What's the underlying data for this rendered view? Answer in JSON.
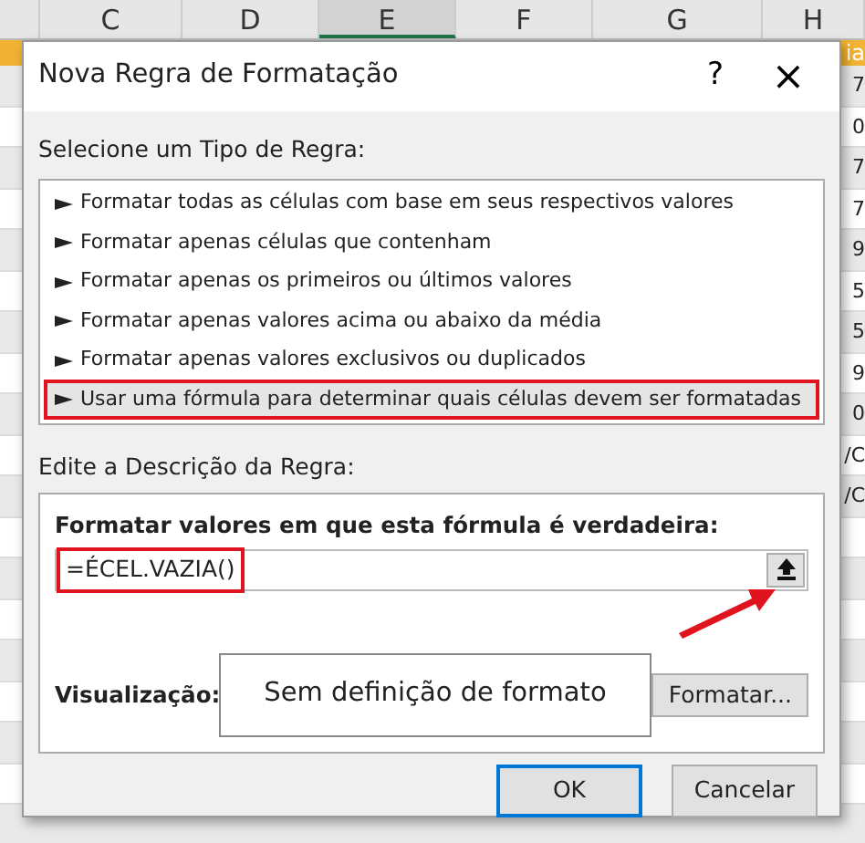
{
  "sheet": {
    "columns": [
      {
        "label": "C",
        "selected": false
      },
      {
        "label": "D",
        "selected": false
      },
      {
        "label": "E",
        "selected": true
      },
      {
        "label": "F",
        "selected": false
      },
      {
        "label": "G",
        "selected": false
      },
      {
        "label": "H",
        "selected": false
      }
    ],
    "header_fragment": "ia",
    "edge_fragments": [
      "7",
      "0",
      "7",
      "7",
      "9",
      "5",
      "5",
      "9",
      "0",
      "/C",
      "/C"
    ]
  },
  "dialog": {
    "title": "Nova Regra de Formatação",
    "help": "?",
    "close": "×",
    "rule_type_label": "Selecione um Tipo de Regra:",
    "rule_types": [
      {
        "label": "Formatar todas as células com base em seus respectivos valores",
        "selected": false
      },
      {
        "label": "Formatar apenas células que contenham",
        "selected": false
      },
      {
        "label": "Formatar apenas os primeiros ou últimos valores",
        "selected": false
      },
      {
        "label": "Formatar apenas valores acima ou abaixo da média",
        "selected": false
      },
      {
        "label": "Formatar apenas valores exclusivos ou duplicados",
        "selected": false
      },
      {
        "label": "Usar uma fórmula para determinar quais células devem ser formatadas",
        "selected": true
      }
    ],
    "description_label": "Edite a Descrição da Regra:",
    "formula_label": "Formatar valores em que esta fórmula é verdadeira:",
    "formula": {
      "value": "=ÉCEL.VAZIA()",
      "highlighted": true
    },
    "preview_label": "Visualização:",
    "preview_text": "Sem definição de formato",
    "format_button": "Formatar...",
    "buttons": [
      {
        "label": "OK",
        "default": true
      },
      {
        "label": "Cancelar",
        "default": false
      }
    ]
  }
}
